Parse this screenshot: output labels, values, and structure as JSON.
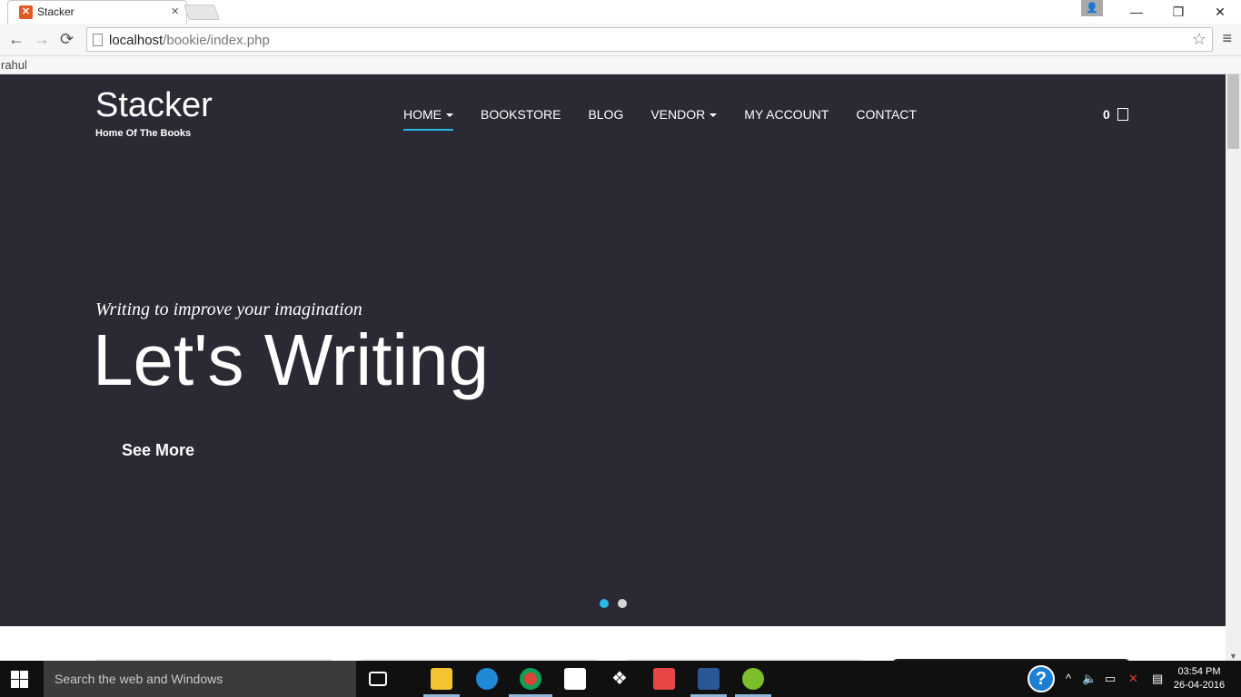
{
  "browser": {
    "tab_title": "Stacker",
    "tab_close": "×",
    "url_host": "localhost",
    "url_path": "/bookie/index.php",
    "bookmark": "rahul",
    "minimize": "—",
    "restore": "❐",
    "close": "✕",
    "back": "←",
    "forward": "→",
    "reload": "⟳",
    "star": "☆",
    "menu": "≡"
  },
  "site": {
    "brand_name": "Stacker",
    "brand_tagline": "Home Of The Books",
    "nav": [
      {
        "label": "HOME"
      },
      {
        "label": "BOOKSTORE"
      },
      {
        "label": "BLOG"
      },
      {
        "label": "VENDOR"
      },
      {
        "label": "MY ACCOUNT"
      },
      {
        "label": "CONTACT"
      }
    ],
    "cart_count": "0"
  },
  "hero": {
    "subtitle": "Writing to improve your imagination",
    "title": "Let's Writing",
    "cta": "See More",
    "active_slide": 1,
    "slide_count": 2
  },
  "taskbar": {
    "search_placeholder": "Search the web and Windows",
    "help": "?",
    "time": "03:54 PM",
    "date": "26-04-2016"
  },
  "colors": {
    "hero_bg": "#2b2933",
    "accent": "#2ab6e3"
  },
  "icons": [
    "file-explorer-icon",
    "edge-icon",
    "chrome-icon",
    "store-icon",
    "dropbox-icon",
    "wps-icon",
    "word-icon",
    "app-icon"
  ]
}
